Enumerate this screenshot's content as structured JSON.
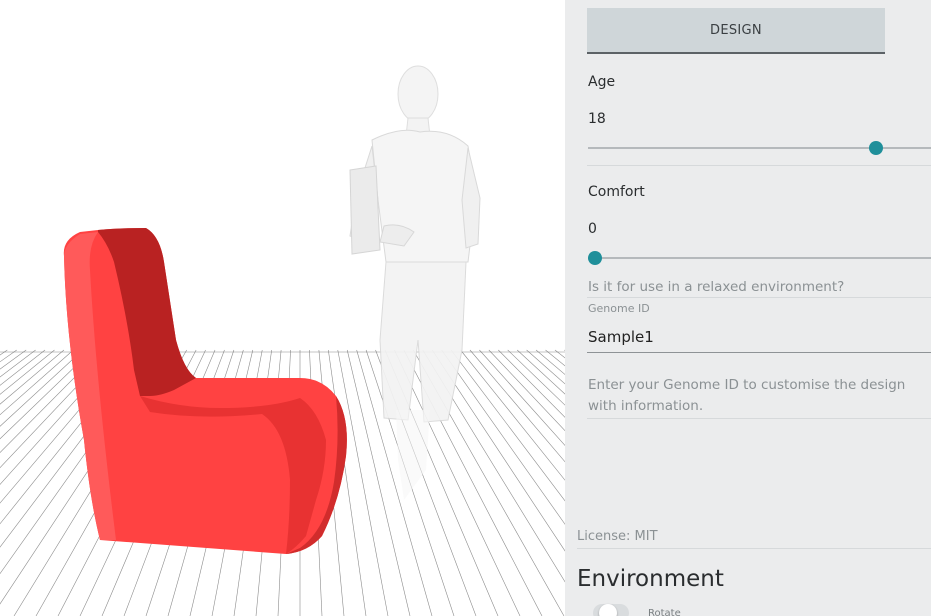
{
  "viewport": {
    "chair_color": "#ff4242",
    "chair_shadow_color": "#b92222",
    "figure_color": "#f2f2f2",
    "grid_line_color": "#666666"
  },
  "panel": {
    "design_button": "DESIGN",
    "age": {
      "label": "Age",
      "value": "18",
      "fraction": 0.84
    },
    "comfort": {
      "label": "Comfort",
      "value": "0",
      "fraction": 0.0,
      "hint": "Is it for use in a relaxed environment?"
    },
    "genome": {
      "label": "Genome ID",
      "value": "Sample1",
      "hint": "Enter your Genome ID to customise the design with information."
    },
    "license": "License: MIT",
    "environment": {
      "title": "Environment",
      "toggle_label": "Rotate"
    },
    "accent_color": "#1f8f9a"
  }
}
